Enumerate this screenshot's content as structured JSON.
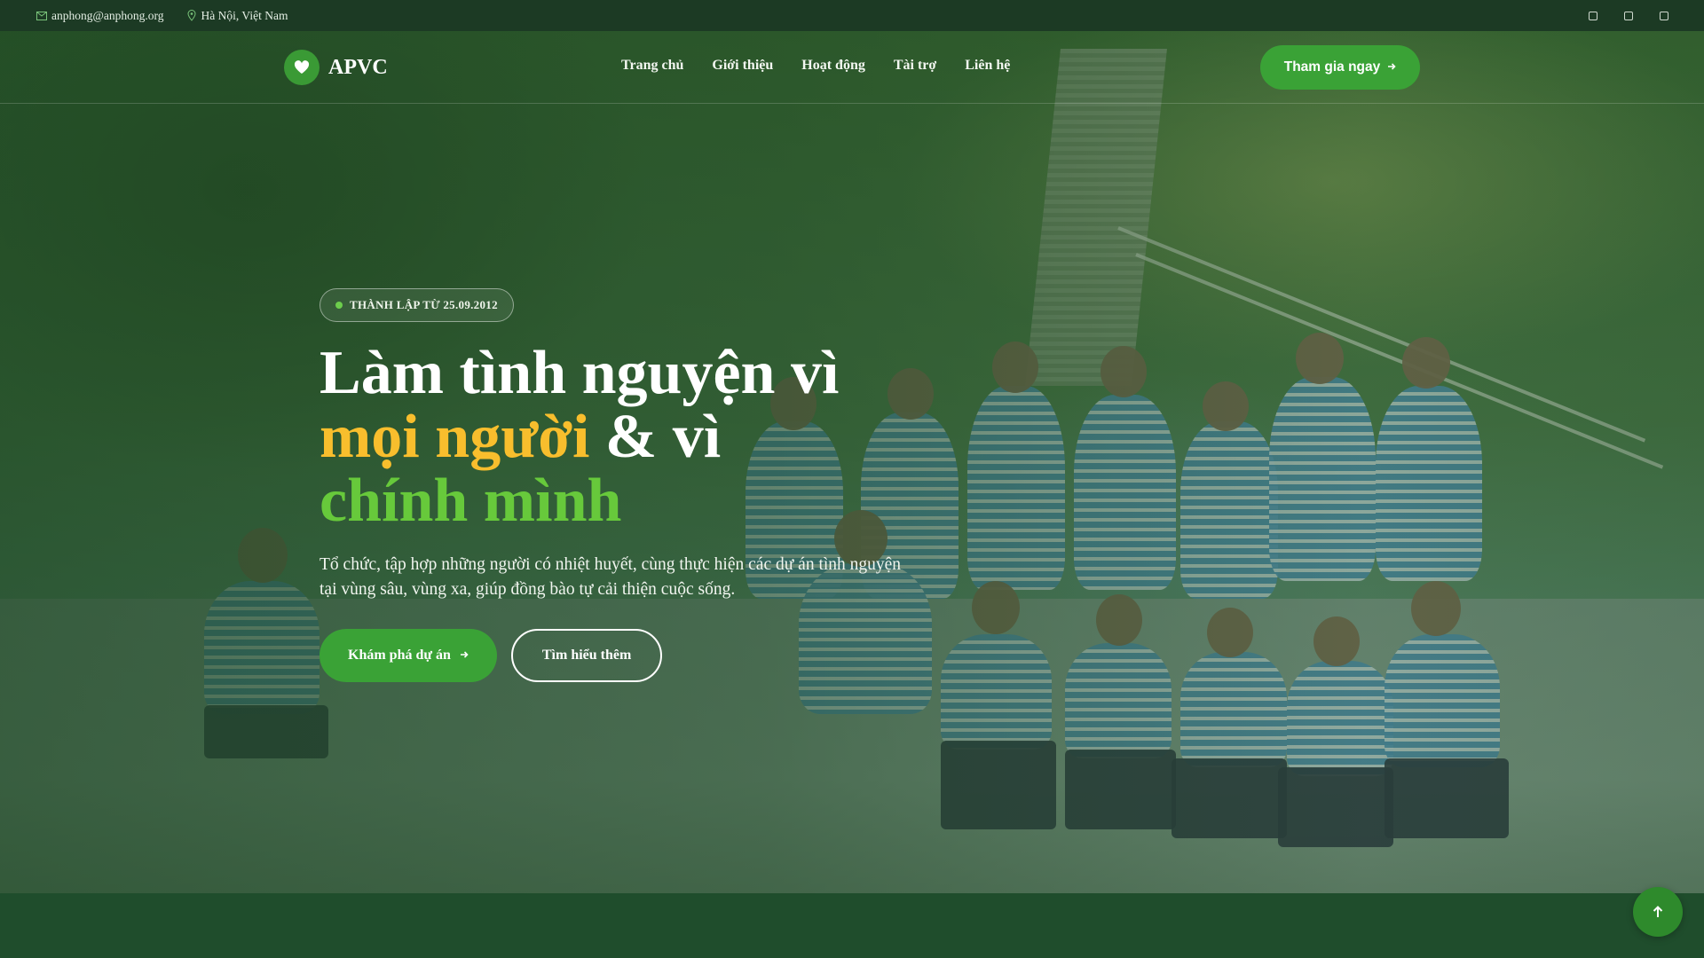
{
  "topbar": {
    "email": "anphong@anphong.org",
    "location": "Hà Nội, Việt Nam",
    "email_icon": "mail-icon",
    "location_icon": "map-pin-icon",
    "socials": [
      "facebook-icon",
      "youtube-icon",
      "instagram-icon"
    ]
  },
  "brand": {
    "name": "APVC",
    "logo_icon": "heart-hand-icon"
  },
  "nav": {
    "items": [
      {
        "label": "Trang chủ"
      },
      {
        "label": "Giới thiệu"
      },
      {
        "label": "Hoạt động"
      },
      {
        "label": "Tài trợ"
      },
      {
        "label": "Liên hệ"
      }
    ],
    "join_label": "Tham gia ngay"
  },
  "hero": {
    "badge": "THÀNH LẬP TỪ 25.09.2012",
    "headline_line1": "Làm tình nguyện vì",
    "headline_highlight_yellow": "mọi người",
    "headline_and": " & vì",
    "headline_highlight_green": "chính mình",
    "description": "Tổ chức, tập hợp những người có nhiệt huyết, cùng thực hiện các dự án tình nguyện tại vùng sâu, vùng xa, giúp đồng bào tự cải thiện cuộc sống.",
    "primary_cta": "Khám phá dự án",
    "secondary_cta": "Tìm hiểu thêm"
  },
  "fab_icon": "arrow-up-icon",
  "colors": {
    "brand_green": "#3aa236",
    "topbar_bg": "#1c3a24",
    "highlight_yellow": "#f8be2d",
    "highlight_green": "#67c93b"
  }
}
